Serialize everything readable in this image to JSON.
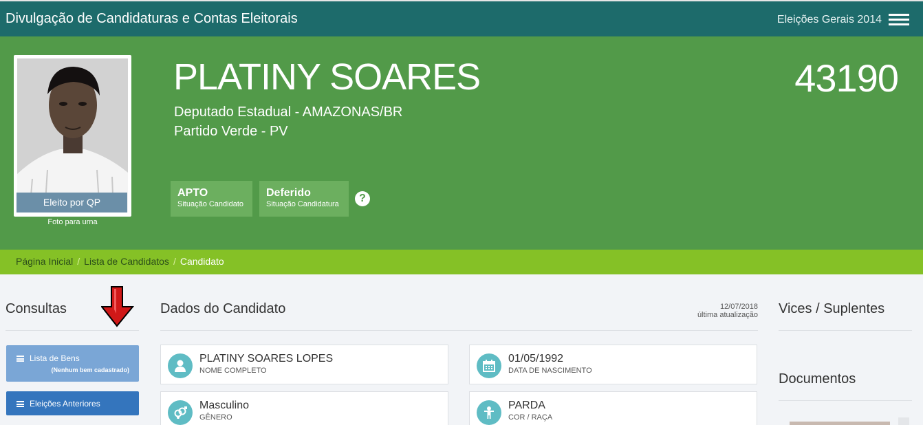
{
  "header": {
    "app_title": "Divulgação de Candidaturas e Contas Eleitorais",
    "election": "Eleições Gerais 2014"
  },
  "candidate": {
    "photo_badge": "Eleito por QP",
    "photo_caption": "Foto para urna",
    "name": "PLATINY SOARES",
    "office": "Deputado Estadual - AMAZONAS/BR",
    "party": "Partido Verde - PV",
    "number": "43190",
    "statuses": [
      {
        "value": "APTO",
        "label": "Situação Candidato"
      },
      {
        "value": "Deferido",
        "label": "Situação Candidatura"
      }
    ],
    "help_symbol": "?"
  },
  "breadcrumb": {
    "items": [
      "Página Inicial",
      "Lista de Candidatos"
    ],
    "current": "Candidato",
    "separator": "/"
  },
  "sidebar": {
    "title": "Consultas",
    "buttons": [
      {
        "label": "Lista de Bens",
        "sub": "(Nenhum bem cadastrado)"
      },
      {
        "label": "Eleições Anteriores"
      }
    ]
  },
  "main": {
    "title": "Dados do Candidato",
    "update_date": "12/07/2018",
    "update_label": "última atualização",
    "cards": [
      {
        "value": "PLATINY SOARES LOPES",
        "label": "NOME COMPLETO",
        "icon": "user-icon"
      },
      {
        "value": "01/05/1992",
        "label": "DATA DE NASCIMENTO",
        "icon": "calendar-icon"
      },
      {
        "value": "Masculino",
        "label": "GÊNERO",
        "icon": "gender-icon"
      },
      {
        "value": "PARDA",
        "label": "COR / RAÇA",
        "icon": "person-icon"
      }
    ]
  },
  "right": {
    "vices_title": "Vices / Suplentes",
    "docs_title": "Documentos"
  },
  "colors": {
    "topbar": "#1d6b6b",
    "hero": "#529a49",
    "breadcrumb": "#85c126",
    "card_icon": "#5fbcc4",
    "btn_bens": "#7aa6d6",
    "btn_eleicoes": "#3475bd"
  }
}
